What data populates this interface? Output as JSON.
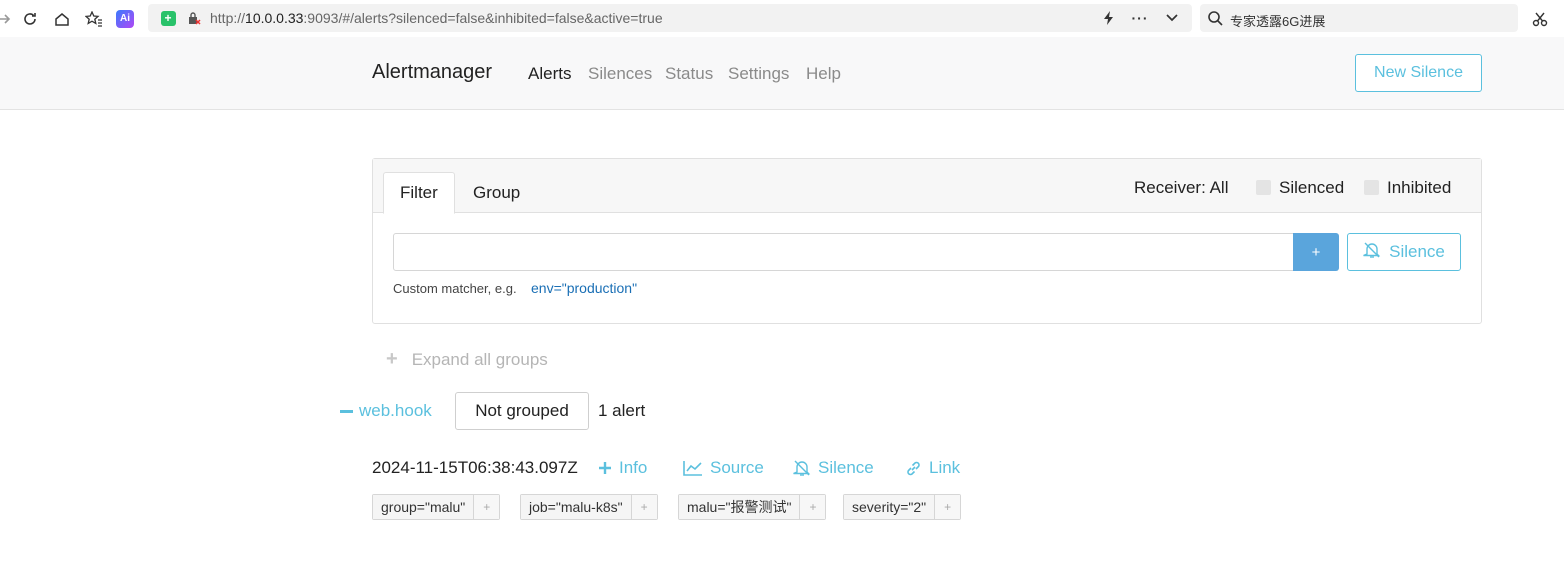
{
  "browser": {
    "url_prefix": "http://",
    "url_host": "10.0.0.33",
    "url_rest": ":9093/#/alerts?silenced=false&inhibited=false&active=true",
    "search_text": "专家透露6G进展",
    "ai_badge": "Ai"
  },
  "navbar": {
    "brand": "Alertmanager",
    "links": [
      "Alerts",
      "Silences",
      "Status",
      "Settings",
      "Help"
    ],
    "new_silence": "New Silence"
  },
  "filter_card": {
    "tabs": [
      "Filter",
      "Group"
    ],
    "receiver": "Receiver: All",
    "silenced_label": "Silenced",
    "inhibited_label": "Inhibited",
    "input_value": "",
    "add_button": "+",
    "silence_button": "Silence",
    "hint_text": "Custom matcher, e.g.",
    "hint_example": "env=\"production\""
  },
  "expand_all": "Expand all groups",
  "group": {
    "receiver": "web.hook",
    "grouping": "Not grouped",
    "count": "1 alert"
  },
  "alert": {
    "timestamp": "2024-11-15T06:38:43.097Z",
    "actions": [
      "Info",
      "Source",
      "Silence",
      "Link"
    ],
    "labels": [
      "group=\"malu\"",
      "job=\"malu-k8s\"",
      "malu=\"报警测试\"",
      "severity=\"2\""
    ],
    "label_add": "+"
  },
  "colors": {
    "accent": "#5bc0de",
    "primary_button": "#5aa5dc",
    "link_code": "#1a6fb5"
  }
}
